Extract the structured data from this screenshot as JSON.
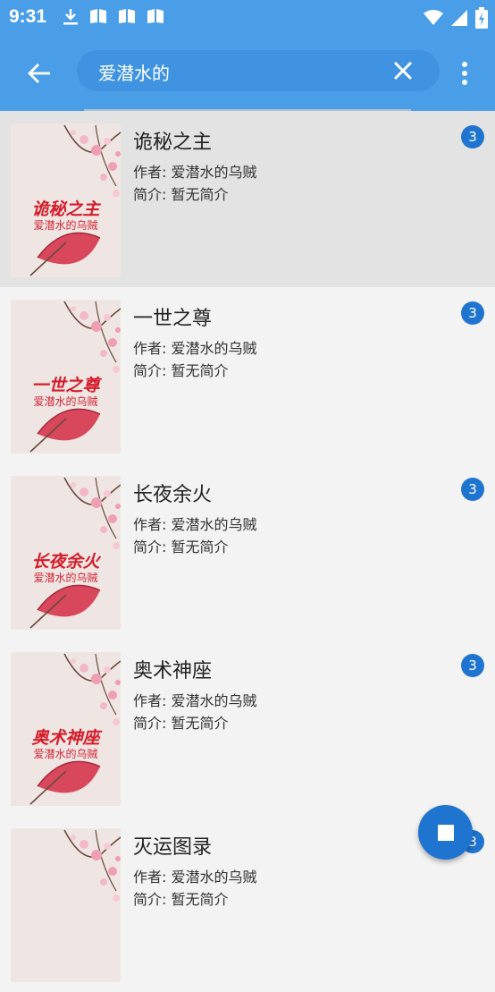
{
  "status_bar": {
    "time": "9:31",
    "left_icons": [
      "download-icon",
      "book-icon",
      "book-icon",
      "book-icon"
    ],
    "right_icons": [
      "wifi-icon",
      "signal-icon",
      "battery-icon"
    ]
  },
  "toolbar": {
    "back_icon": "arrow-left-icon",
    "search_value": "爱潜水的",
    "clear_icon": "close-icon",
    "more_icon": "more-vert-icon"
  },
  "results": [
    {
      "title": "诡秘之主",
      "cover_title": "诡秘之主",
      "cover_author": "爱潜水的乌贼",
      "author_line": "作者: 爱潜水的乌贼",
      "intro_line": "简介: 暂无简介",
      "badge": "3",
      "selected": true
    },
    {
      "title": "一世之尊",
      "cover_title": "一世之尊",
      "cover_author": "爱潜水的乌贼",
      "author_line": "作者: 爱潜水的乌贼",
      "intro_line": "简介: 暂无简介",
      "badge": "3",
      "selected": false
    },
    {
      "title": "长夜余火",
      "cover_title": "长夜余火",
      "cover_author": "爱潜水的乌贼",
      "author_line": "作者: 爱潜水的乌贼",
      "intro_line": "简介: 暂无简介",
      "badge": "3",
      "selected": false
    },
    {
      "title": "奥术神座",
      "cover_title": "奥术神座",
      "cover_author": "爱潜水的乌贼",
      "author_line": "作者: 爱潜水的乌贼",
      "intro_line": "简介: 暂无简介",
      "badge": "3",
      "selected": false
    },
    {
      "title": "灭运图录",
      "cover_title": "",
      "cover_author": "",
      "author_line": "作者: 爱潜水的乌贼",
      "intro_line": "简介: 暂无简介",
      "badge": "3",
      "selected": false
    }
  ],
  "fab": {
    "icon": "stop-icon"
  },
  "colors": {
    "primary": "#4a9ee8",
    "accent": "#1f74cf",
    "cover_text": "#d51c2a"
  }
}
